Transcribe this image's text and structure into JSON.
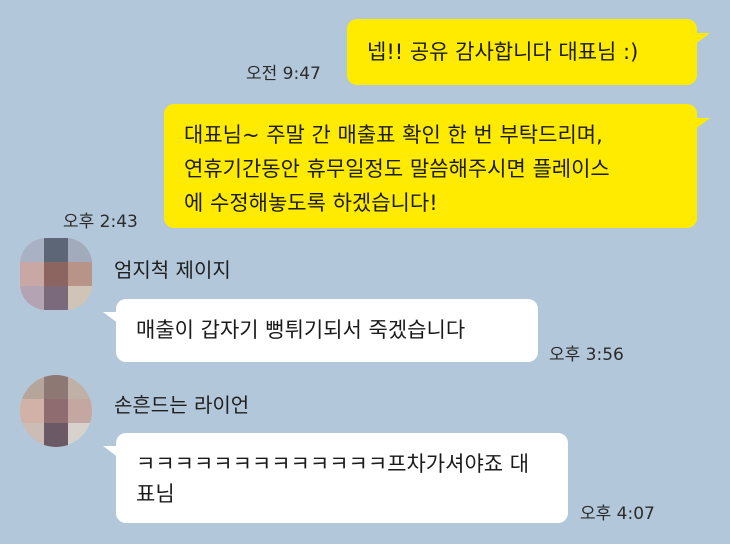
{
  "theme": {
    "background": "#b2c7d9",
    "my_bubble": "#ffeb00",
    "their_bubble": "#ffffff"
  },
  "messages": [
    {
      "side": "mine",
      "text": "넵!! 공유 감사합니다 대표님 :)",
      "time": "오전 9:47"
    },
    {
      "side": "mine",
      "text": "대표님~ 주말 간 매출표 확인 한 번 부탁드리며,\n연휴기간동안 휴무일정도 말씀해주시면 플레이스\n에 수정해놓도록 하겠습니다!",
      "time": "오후 2:43"
    },
    {
      "side": "theirs",
      "sender": "엄지척 제이지",
      "avatar_icon": "blurred-profile-icon",
      "text": "매출이 갑자기 뻥튀기되서 죽겠습니다",
      "time": "오후 3:56"
    },
    {
      "side": "theirs",
      "sender": "손흔드는 라이언",
      "avatar_icon": "blurred-profile-icon",
      "text": "ㅋㅋㅋㅋㅋㅋㅋㅋㅋㅋㅋㅋㅋ프차가셔야죠 대\n표님",
      "time": "오후 4:07"
    }
  ]
}
